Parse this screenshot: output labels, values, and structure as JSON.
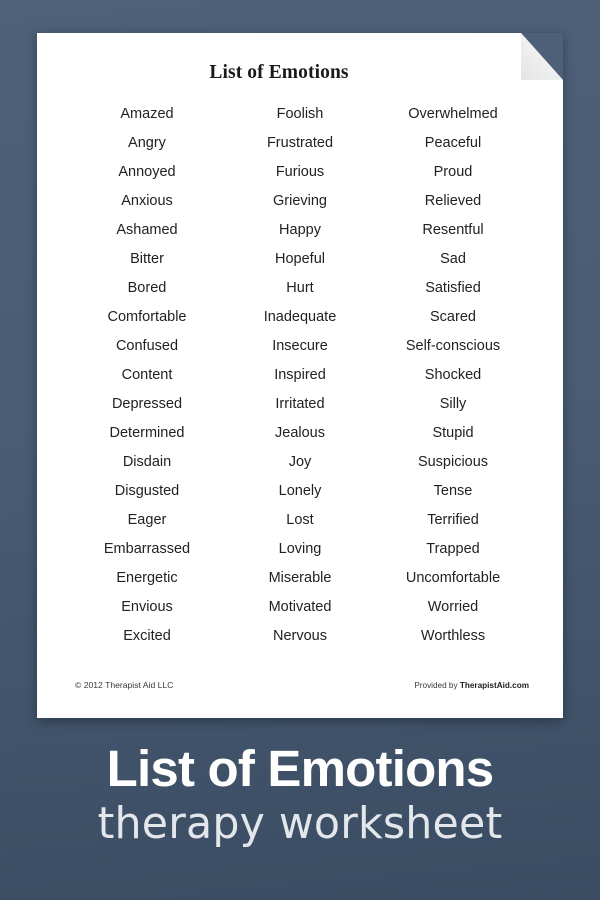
{
  "theme": {
    "background_top": "#4e6179",
    "background_bottom": "#3a4c62",
    "page_background": "#ffffff",
    "text_color": "#222222",
    "caption_color": "#ffffff"
  },
  "worksheet": {
    "title": "List of Emotions",
    "columns": [
      {
        "id": "column-1",
        "items": [
          "Amazed",
          "Angry",
          "Annoyed",
          "Anxious",
          "Ashamed",
          "Bitter",
          "Bored",
          "Comfortable",
          "Confused",
          "Content",
          "Depressed",
          "Determined",
          "Disdain",
          "Disgusted",
          "Eager",
          "Embarrassed",
          "Energetic",
          "Envious",
          "Excited"
        ]
      },
      {
        "id": "column-2",
        "items": [
          "Foolish",
          "Frustrated",
          "Furious",
          "Grieving",
          "Happy",
          "Hopeful",
          "Hurt",
          "Inadequate",
          "Insecure",
          "Inspired",
          "Irritated",
          "Jealous",
          "Joy",
          "Lonely",
          "Lost",
          "Loving",
          "Miserable",
          "Motivated",
          "Nervous"
        ]
      },
      {
        "id": "column-3",
        "items": [
          "Overwhelmed",
          "Peaceful",
          "Proud",
          "Relieved",
          "Resentful",
          "Sad",
          "Satisfied",
          "Scared",
          "Self-conscious",
          "Shocked",
          "Silly",
          "Stupid",
          "Suspicious",
          "Tense",
          "Terrified",
          "Trapped",
          "Uncomfortable",
          "Worried",
          "Worthless"
        ]
      }
    ],
    "footer": {
      "copyright": "© 2012 Therapist Aid LLC",
      "provided_prefix": "Provided by ",
      "provided_brand": "TherapistAid.com"
    },
    "corner_fold_icon": "page-corner-fold"
  },
  "caption": {
    "main": "List of Emotions",
    "sub": "therapy worksheet"
  }
}
